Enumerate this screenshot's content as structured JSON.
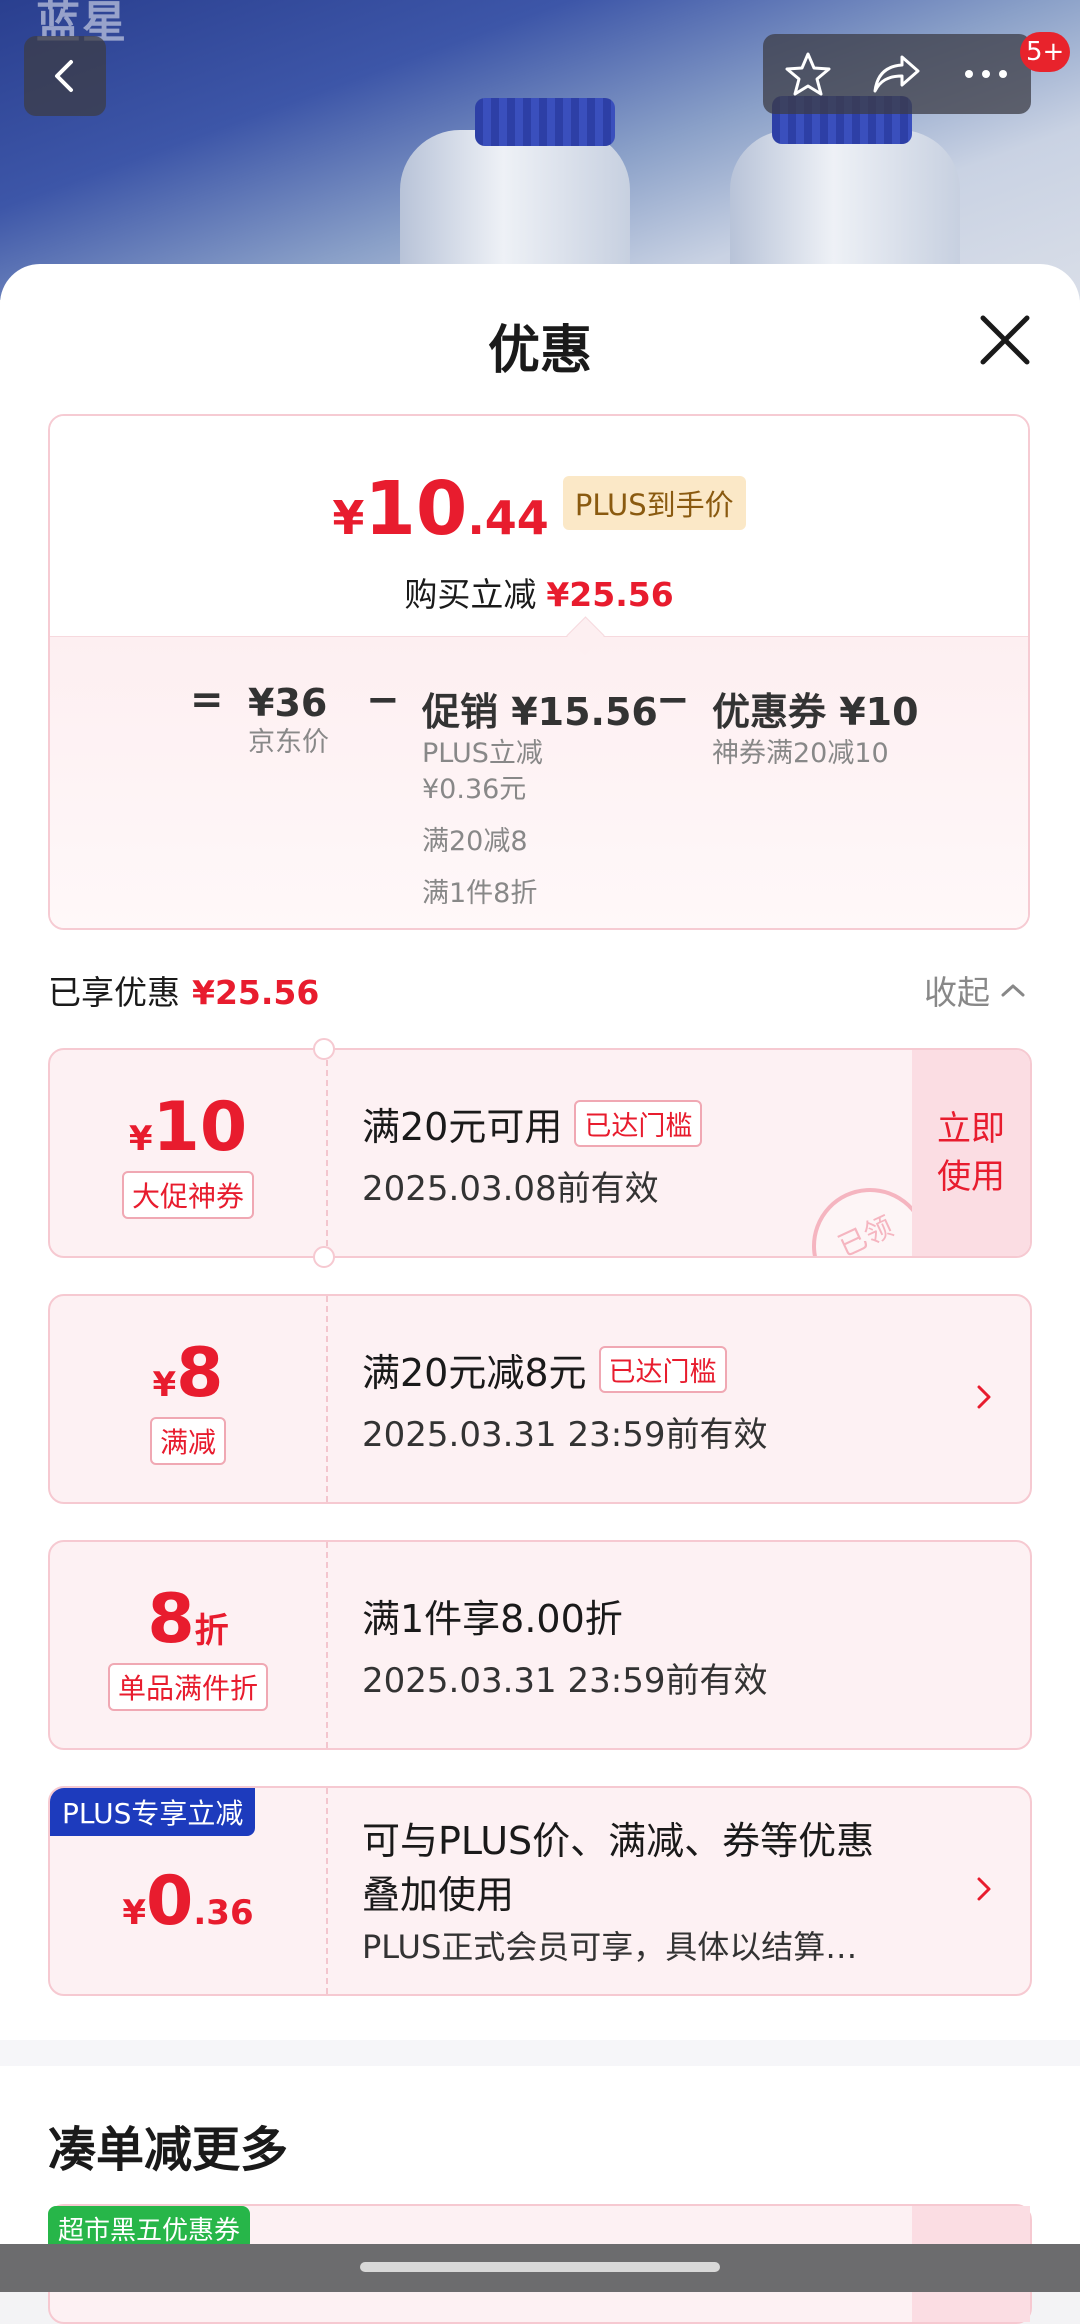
{
  "header": {
    "brand_text": "蓝星",
    "message_badge": "5+"
  },
  "sheet": {
    "title": "优惠"
  },
  "summary": {
    "price_symbol": "¥",
    "price_integer": "10",
    "price_decimal": ".44",
    "price_tag": "PLUS到手价",
    "save_label": "购买立减",
    "save_amount": "¥25.56",
    "equals": "=",
    "minus": "−",
    "jd_price": "¥36",
    "jd_price_label": "京东价",
    "promo": "促销 ¥15.56",
    "promo_details": [
      "PLUS立减",
      "¥0.36元",
      "满20减8",
      "满1件8折"
    ],
    "coupon": "优惠券 ¥10",
    "coupon_detail": "神券满20减10"
  },
  "enjoyed": {
    "label": "已享优惠",
    "amount": "¥25.56",
    "collapse_label": "收起"
  },
  "coupons": [
    {
      "currency": "¥",
      "amount": "10",
      "tag": "大促神券",
      "condition": "满20元可用",
      "reached": "已达门槛",
      "validity": "2025.03.08前有效",
      "action": "立即使用",
      "stamp": "已领"
    },
    {
      "currency": "¥",
      "amount": "8",
      "tag": "满减",
      "condition": "满20元减8元",
      "reached": "已达门槛",
      "validity": "2025.03.31 23:59前有效"
    },
    {
      "amount": "8",
      "unit": "折",
      "tag": "单品满件折",
      "condition": "满1件享8.00折",
      "validity": "2025.03.31 23:59前有效"
    },
    {
      "corner_tag": "PLUS专享立减",
      "currency": "¥",
      "amount": "0",
      "decimal": ".36",
      "description_line1": "可与PLUS价、满减、券等优惠",
      "description_line2": "叠加使用",
      "note": "PLUS正式会员可享，具体以结算…"
    }
  ],
  "more": {
    "title": "凑单减更多",
    "peek_tag": "超市黑五优惠券"
  },
  "colors": {
    "accent_red": "#e81c2e",
    "plus_blue": "#1d3bbd",
    "market_green": "#27b649",
    "card_pink": "#fdf1f3"
  }
}
